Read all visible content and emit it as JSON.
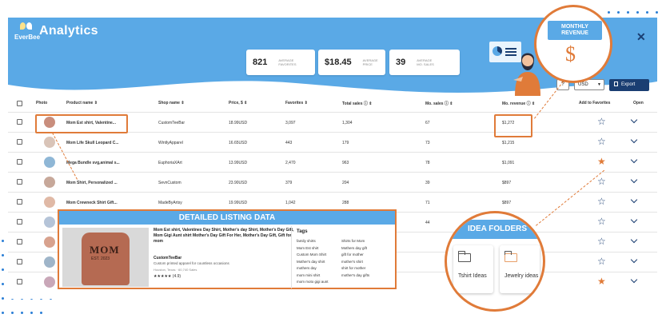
{
  "app": {
    "logo_text": "EverBee",
    "title": "Analytics"
  },
  "stats": [
    {
      "value": "821",
      "label": "AVERAGE FAVORITES"
    },
    {
      "value": "$18.45",
      "label": "AVERAGE PRICE"
    },
    {
      "value": "39",
      "label": "AVERAGE MO. SALES"
    }
  ],
  "toolbar": {
    "help_label": "?",
    "currency": "USD",
    "export_label": "Export"
  },
  "table": {
    "headers": {
      "photo": "Photo",
      "product": "Product name ⇕",
      "shop": "Shop name ⇕",
      "price": "Price, $ ⇕",
      "favorites": "Favorites ⇕",
      "total_sales": "Total sales ⓘ ⇕",
      "mo_sales": "Mo. sales ⓘ ⇕",
      "mo_revenue": "Mo. revenue ⓘ ⇕",
      "add_fav": "Add to Favorites",
      "open": "Open"
    },
    "rows": [
      {
        "product": "Mom Est shirt, Valentine...",
        "shop": "CustomTeeBar",
        "price": "18.99USD",
        "favorites": "3,097",
        "total_sales": "1,304",
        "mo_sales": "67",
        "mo_revenue": "$1,272",
        "fav": false
      },
      {
        "product": "Mom Life Skull Leopard C...",
        "shop": "WintlyApparel",
        "price": "16.65USD",
        "favorites": "443",
        "total_sales": "179",
        "mo_sales": "73",
        "mo_revenue": "$1,215",
        "fav": false
      },
      {
        "product": "Mega Bundle svg,animal s...",
        "shop": "EuphoriaXArt",
        "price": "13.99USD",
        "favorites": "2,470",
        "total_sales": "963",
        "mo_sales": "78",
        "mo_revenue": "$1,091",
        "fav": true
      },
      {
        "product": "Mom Shirt, Personalized ...",
        "shop": "SevnCustom",
        "price": "23.90USD",
        "favorites": "379",
        "total_sales": "204",
        "mo_sales": "39",
        "mo_revenue": "$897",
        "fav": false
      },
      {
        "product": "Mom Crewneck Shirt Gift...",
        "shop": "MadeByArtsy",
        "price": "19.99USD",
        "favorites": "1,042",
        "total_sales": "288",
        "mo_sales": "71",
        "mo_revenue": "$897",
        "fav": false
      },
      {
        "product": "",
        "shop": "",
        "price": "",
        "favorites": "",
        "total_sales": "",
        "mo_sales": "44",
        "mo_revenue": "",
        "fav": false
      },
      {
        "product": "",
        "shop": "",
        "price": "",
        "favorites": "",
        "total_sales": "",
        "mo_sales": "",
        "mo_revenue": "",
        "fav": false
      },
      {
        "product": "",
        "shop": "",
        "price": "",
        "favorites": "",
        "total_sales": "",
        "mo_sales": "",
        "mo_revenue": "",
        "fav": false
      },
      {
        "product": "",
        "shop": "",
        "price": "",
        "favorites": "",
        "total_sales": "",
        "mo_sales": "",
        "mo_revenue": "",
        "fav": true
      }
    ]
  },
  "callouts": {
    "monthly_revenue": "MONTHLY REVENUE",
    "dollar": "$",
    "detailed_listing": "DETAILED LISTING DATA",
    "idea_folders": "IDEA FOLDERS"
  },
  "folders": [
    {
      "label": "Tshirt Ideas",
      "color": "#555555"
    },
    {
      "label": "Jewelry ideas",
      "color": "#e8a06a"
    }
  ],
  "detail": {
    "shirt_text": "MOM",
    "shirt_sub": "EST. 2023",
    "description": "Mom Est shirt, Valentines Day Shirt, Mother's day Shirt, Mother's Day Gift, Mom Gigi Aunt shirt Mother's Day Gift For Her, Mother's Day Gift, Gift for mom",
    "shop": "CustomTeeBar",
    "shop_desc": "Custom printed apparel for countless occasions",
    "location": "Houston, Texas · 60,740 Sales",
    "rating": "★★★★★ (4.9)",
    "tags_label": "Tags",
    "tags": [
      "family shirts",
      "Mom Est shirt",
      "Custom Mom Shirt",
      "Mother's day shirt",
      "mothers day",
      "mom mini shirt",
      "mom moto gigi aunt",
      "Shirts for Mom",
      "Mothers day gift",
      "gift for mother",
      "mother's shirt",
      "shirt for mother",
      "mother's day gifts"
    ]
  },
  "colors": {
    "accent": "#5aa9e6",
    "brand_dark": "#1a3e72",
    "highlight": "#e07b39"
  }
}
